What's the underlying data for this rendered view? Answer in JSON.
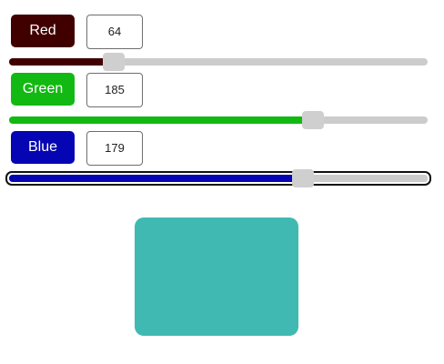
{
  "channels": [
    {
      "label": "Red",
      "value": "64",
      "fraction": 0.251,
      "label_color": "#400000",
      "fill_color": "#400000"
    },
    {
      "label": "Green",
      "value": "185",
      "fraction": 0.725,
      "label_color": "#12b912",
      "fill_color": "#12b912"
    },
    {
      "label": "Blue",
      "value": "179",
      "fraction": 0.702,
      "label_color": "#0505b3",
      "fill_color": "#0505b3"
    }
  ],
  "preview": {
    "color": "#40b9b3"
  }
}
